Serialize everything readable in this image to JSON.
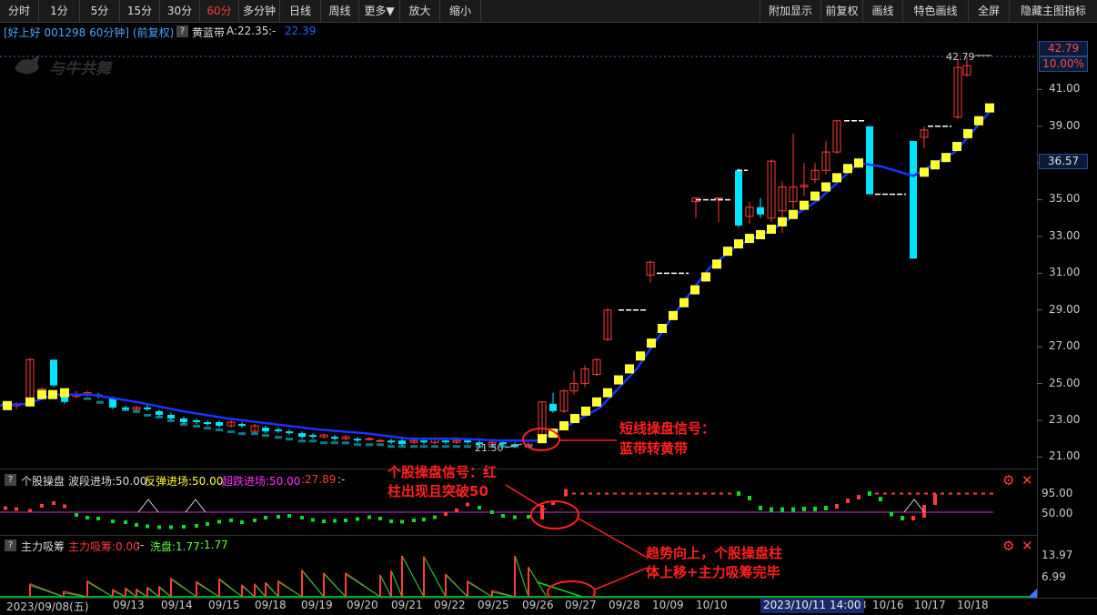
{
  "toolbar": {
    "periods": [
      "分时",
      "1分",
      "5分",
      "15分",
      "30分",
      "60分",
      "多分钟",
      "日线",
      "周线",
      "更多▼",
      "放大",
      "缩小"
    ],
    "active_period": "60分",
    "right_buttons": [
      "附加显示",
      "前复权",
      "画线",
      "特色画线",
      "全屏",
      "隐藏主图指标"
    ]
  },
  "main_header": {
    "stock": "[好上好 001298 60分钟] (前复权)",
    "indicator_name": "黄蓝带",
    "indicator_a": "A:22.35",
    "indicator_sep": ":-",
    "indicator_b": "22.39"
  },
  "watermark": "与牛共舞",
  "price_axis": {
    "ticks": [
      "41.00",
      "39.00",
      "37.00",
      "35.00",
      "33.00",
      "31.00",
      "29.00",
      "27.00",
      "25.00",
      "23.00",
      "21.00"
    ],
    "top_price": "42.79",
    "top_pct": "10.00%",
    "cursor_price": "36.57"
  },
  "chart_labels": {
    "high_price": "42.79",
    "low_price": "21.50"
  },
  "indicator1": {
    "name": "个股操盘",
    "item1": "波段进场:50.00",
    "item2": "反弹进场:50.00",
    "item3": "超跌进场:50.00",
    "item4": ":27.89",
    "item5": ":-",
    "ticks": [
      "95.00",
      "50.00"
    ]
  },
  "indicator2": {
    "name": "主力吸筹",
    "item1": "主力吸筹:0.00",
    "item2": ":-",
    "item3": "洗盘:1.77",
    "item4": ":1.77",
    "ticks": [
      "13.97",
      "6.99"
    ]
  },
  "date_axis": {
    "first": "2023/09/08(五)",
    "labels": [
      "09/13",
      "09/14",
      "09/15",
      "09/18",
      "09/19",
      "09/20",
      "09/21",
      "09/22",
      "09/25",
      "09/26",
      "09/27",
      "09/28",
      "10/09",
      "10/10",
      "10/13",
      "10/16",
      "10/17",
      "10/18"
    ],
    "cursor": "2023/10/11 14:00"
  },
  "annotations": {
    "short_signal_line1": "短线操盘信号：",
    "short_signal_line2": "蓝带转黄带",
    "stock_signal_line1": "个股操盘信号：红",
    "stock_signal_line2": "柱出现且突破50",
    "trend_line1": "趋势向上，个股操盘柱",
    "trend_line2": "体上移+主力吸筹完毕"
  },
  "colors": {
    "up": "#ff3b3b",
    "down": "#00e5ff",
    "yellow_band": "#ffff33",
    "blue_band": "#1a33ff",
    "annotation": "#ff2020"
  }
}
